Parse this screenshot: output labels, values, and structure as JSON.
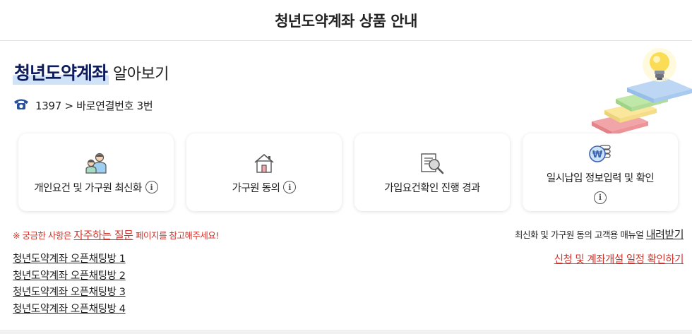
{
  "header": {
    "title": "청년도약계좌 상품 안내"
  },
  "hero": {
    "title_strong": "청년도약계좌",
    "title_light": "알아보기"
  },
  "contact": {
    "icon": "phone-icon",
    "text": "1397 > 바로연결번호 3번"
  },
  "cards": [
    {
      "label": "개인요건 및 가구원 최신화",
      "icon": "family-icon",
      "has_info": true
    },
    {
      "label": "가구원 동의",
      "icon": "house-icon",
      "has_info": true
    },
    {
      "label": "가입요건확인 진행 경과",
      "icon": "document-search-icon",
      "has_info": false
    },
    {
      "label": "일시납입 정보입력 및 확인",
      "icon": "won-coin-icon",
      "has_info": true
    }
  ],
  "info_glyph": "i",
  "notice": {
    "prefix": "※ 궁금한 사항은 ",
    "link": "자주하는 질문",
    "suffix": " 페이지를 참고해주세요!"
  },
  "manual": {
    "text": "최신화 및 가구원 동의 고객용 매뉴얼 ",
    "link": "내려받기"
  },
  "schedule_link": "신청 및 계좌개설 일정 확인하기",
  "chat_links": [
    "청년도약계좌 오픈채팅방 1",
    "청년도약계좌 오픈채팅방 2",
    "청년도약계좌 오픈채팅방 3",
    "청년도약계좌 오픈채팅방 4"
  ],
  "colors": {
    "accent_navy": "#0c1c5c",
    "highlight": "#cfe2f7",
    "alert_red": "#d0342c"
  }
}
